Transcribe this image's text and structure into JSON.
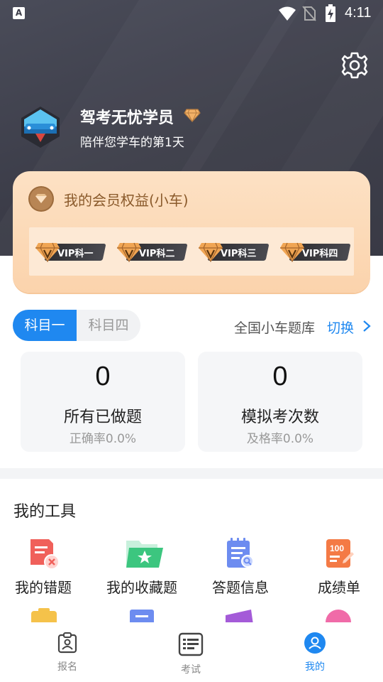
{
  "status_bar": {
    "time": "4:11",
    "app_icon": "A"
  },
  "header": {
    "settings_icon": "gear-icon",
    "user_name": "驾考无忧学员",
    "user_subtitle": "陪伴您学车的第1天"
  },
  "membership": {
    "title": "我的会员权益(小车)",
    "vip_items": [
      "VIP科一",
      "VIP科二",
      "VIP科三",
      "VIP科四"
    ],
    "colors": {
      "card": "#fbd3ac",
      "title": "#8a5a2b"
    }
  },
  "subjects": {
    "tabs": [
      {
        "label": "科目一",
        "selected": true
      },
      {
        "label": "科目四",
        "selected": false
      }
    ],
    "question_bank": "全国小车题库",
    "switch_label": "切换"
  },
  "stats": [
    {
      "value": "0",
      "label": "所有已做题",
      "rate": "正确率0.0%"
    },
    {
      "value": "0",
      "label": "模拟考次数",
      "rate": "及格率0.0%"
    }
  ],
  "tools": {
    "title": "我的工具",
    "items": [
      {
        "label": "我的错题",
        "icon": "wrong-questions-icon"
      },
      {
        "label": "我的收藏题",
        "icon": "favorites-folder-icon"
      },
      {
        "label": "答题信息",
        "icon": "answer-info-icon"
      },
      {
        "label": "成绩单",
        "icon": "score-report-icon"
      }
    ]
  },
  "bottom_nav": [
    {
      "label": "报名",
      "icon": "signup-icon",
      "active": false
    },
    {
      "label": "考试",
      "icon": "exam-icon",
      "active": false
    },
    {
      "label": "我的",
      "icon": "profile-icon",
      "active": true
    }
  ],
  "accent_color": "#1f88f0"
}
